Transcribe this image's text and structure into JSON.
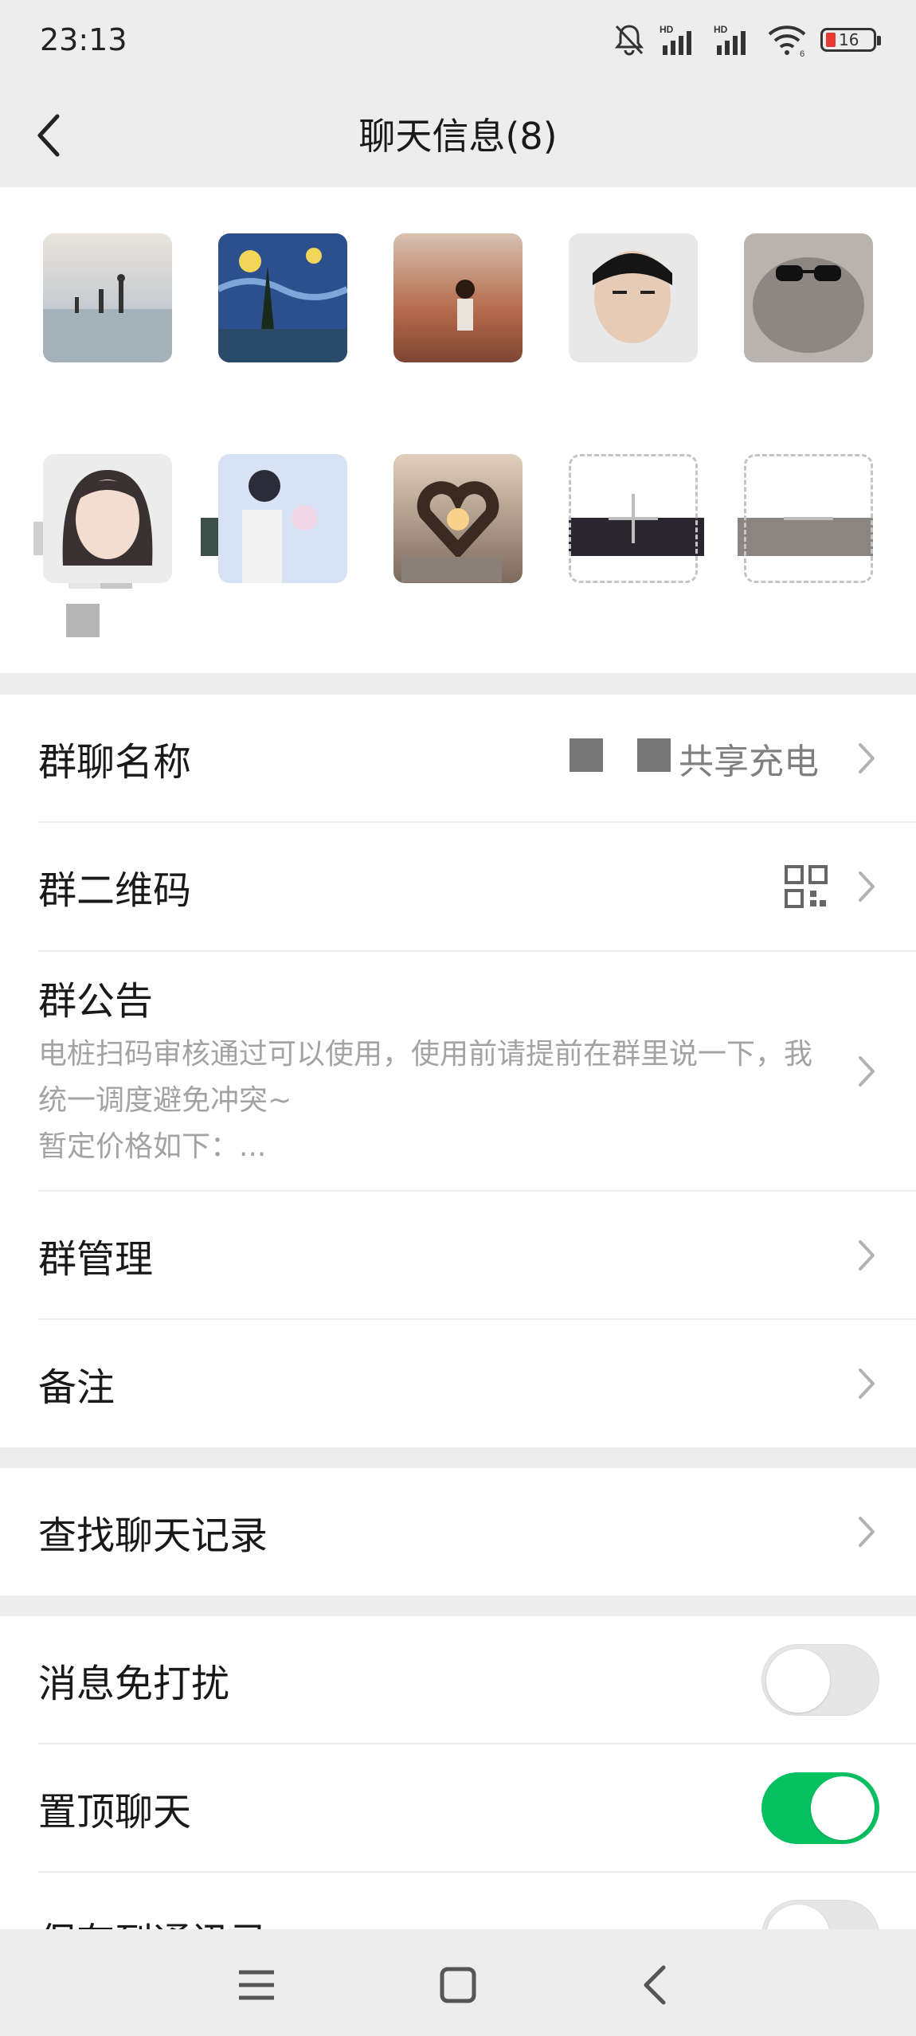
{
  "status": {
    "time": "23:13",
    "battery": "16",
    "network_label_1": "HD",
    "network_label_2": "HD",
    "wifi_label": "6"
  },
  "nav": {
    "title": "聊天信息(8)"
  },
  "members": {
    "count": 8,
    "colors": [
      "#b8c4c9",
      "#2a4f8c",
      "#c98c6c",
      "#2f2f2f",
      "#8a8a8a",
      "#c9c1b8",
      "#cfd9ee",
      "#5a5048"
    ]
  },
  "settings": {
    "group_name_label": "群聊名称",
    "group_name_value": "共享充电",
    "qr_label": "群二维码",
    "announcement_label": "群公告",
    "announcement_text": "电桩扫码审核通过可以使用，使用前请提前在群里说一下，我统一调度避免冲突~\n暂定价格如下：...",
    "management_label": "群管理",
    "remark_label": "备注",
    "search_label": "查找聊天记录",
    "mute_label": "消息免打扰",
    "mute_on": false,
    "pin_label": "置顶聊天",
    "pin_on": true,
    "save_label": "保存到通讯录"
  },
  "colors": {
    "accent_green": "#07c160",
    "background": "#ededed"
  }
}
